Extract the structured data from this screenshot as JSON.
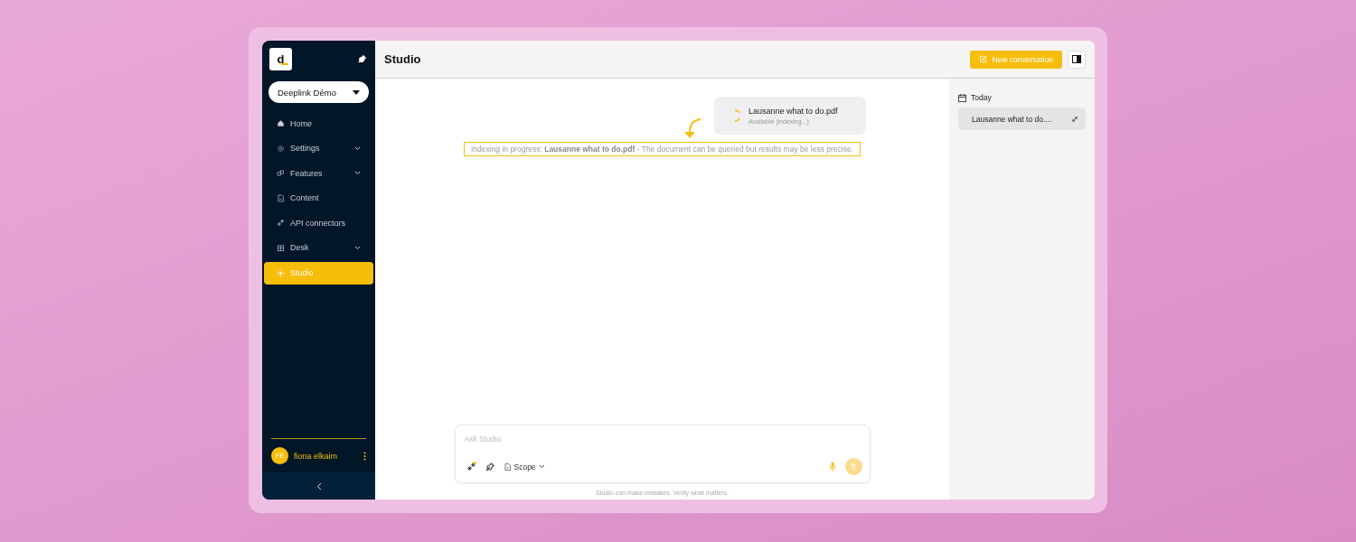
{
  "sidebar": {
    "logo": "d",
    "workspace": "Deeplink Démo",
    "items": [
      {
        "label": "Home",
        "expandable": false,
        "selected": false
      },
      {
        "label": "Settings",
        "expandable": true,
        "selected": false
      },
      {
        "label": "Features",
        "expandable": true,
        "selected": false
      },
      {
        "label": "Content",
        "expandable": false,
        "selected": false
      },
      {
        "label": "API connectors",
        "expandable": false,
        "selected": false
      },
      {
        "label": "Desk",
        "expandable": true,
        "selected": false
      },
      {
        "label": "Studio",
        "expandable": false,
        "selected": true
      }
    ],
    "user": {
      "initials": "FE",
      "name": "fiona elkaim"
    }
  },
  "header": {
    "title": "Studio",
    "new_button": "New conversation"
  },
  "chat": {
    "attachment": {
      "name": "Lausanne what to do.pdf",
      "status": "Available (indexing...)"
    },
    "notice": "Indexing in progress: **Lausanne what to do.pdf** - The document can be queried but results may be less precise.",
    "composer": {
      "placeholder": "Ask Studio",
      "scope": "Scope"
    },
    "disclaimer": "Studio can make mistakes. Verify what matters."
  },
  "history": {
    "group": "Today",
    "items": [
      {
        "title": "Lausanne what to do....",
        "selected": true
      }
    ]
  }
}
